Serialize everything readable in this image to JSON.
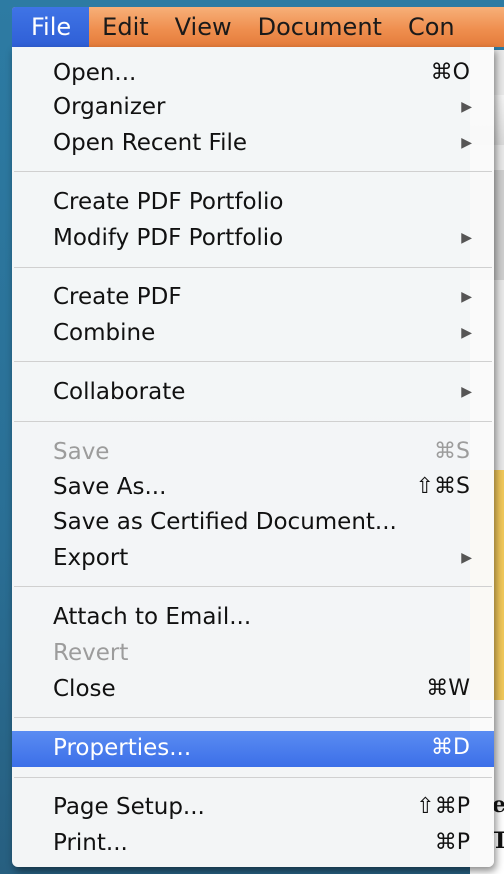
{
  "menubar": {
    "items": [
      {
        "label": "File"
      },
      {
        "label": "Edit"
      },
      {
        "label": "View"
      },
      {
        "label": "Document"
      },
      {
        "label": "Con"
      }
    ]
  },
  "file_menu": {
    "items": [
      {
        "label": "Open...",
        "shortcut": "⌘O"
      },
      {
        "label": "Organizer",
        "submenu": "▶"
      },
      {
        "label": "Open Recent File",
        "submenu": "▶"
      },
      {
        "label": "Create PDF Portfolio"
      },
      {
        "label": "Modify PDF Portfolio",
        "submenu": "▶"
      },
      {
        "label": "Create PDF",
        "submenu": "▶"
      },
      {
        "label": "Combine",
        "submenu": "▶"
      },
      {
        "label": "Collaborate",
        "submenu": "▶"
      },
      {
        "label": "Save",
        "shortcut": "⌘S",
        "disabled": true
      },
      {
        "label": "Save As...",
        "shortcut": "⇧⌘S"
      },
      {
        "label": "Save as Certified Document..."
      },
      {
        "label": "Export",
        "submenu": "▶"
      },
      {
        "label": "Attach to Email..."
      },
      {
        "label": "Revert",
        "disabled": true
      },
      {
        "label": "Close",
        "shortcut": "⌘W"
      },
      {
        "label": "Properties...",
        "shortcut": "⌘D",
        "highlighted": true
      },
      {
        "label": "Page Setup...",
        "shortcut": "⇧⌘P"
      },
      {
        "label": "Print...",
        "shortcut": "⌘P"
      }
    ]
  },
  "background": {
    "partial_text_1": "e",
    "partial_text_2": "T"
  },
  "colors": {
    "menubar_gradient": "#ef8f4f",
    "highlight": "#3c6fe8",
    "desktop": "#2a6f95"
  }
}
